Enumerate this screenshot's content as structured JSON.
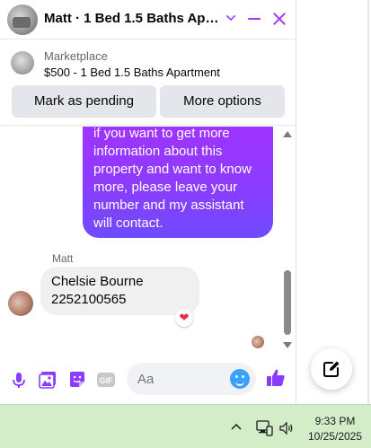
{
  "header": {
    "title": "Matt · 1 Bed 1.5 Baths Apar...",
    "chevron_icon": "chevron-down-icon",
    "minimize_icon": "minimize-icon",
    "close_icon": "close-icon",
    "accent_color": "#a933ff"
  },
  "listing": {
    "source": "Marketplace",
    "title": "$500 - 1 Bed 1.5 Baths Apartment",
    "buttons": {
      "mark_pending": "Mark as pending",
      "more_options": "More options"
    }
  },
  "messages": {
    "outgoing": {
      "lines": [
        "if you want to get more",
        "information about this",
        "property and want to know",
        "more, please leave your",
        "number and my assistant",
        "will contact."
      ],
      "gradient": [
        "#a033ff",
        "#6f4bff"
      ]
    },
    "incoming": {
      "sender": "Matt",
      "lines": [
        "Chelsie Bourne",
        "2252100565"
      ],
      "reaction": "❤"
    }
  },
  "composer": {
    "placeholder": "Aa",
    "icons": [
      "mic-icon",
      "photo-icon",
      "sticker-icon",
      "gif-icon",
      "emoji-icon",
      "thumbs-up-icon"
    ],
    "gif_label": "GIF"
  },
  "fab": {
    "icon": "compose-icon"
  },
  "taskbar": {
    "time": "9:33 PM",
    "date": "10/25/2025",
    "icons": [
      "chevron-up-icon",
      "network-icon",
      "volume-icon"
    ],
    "background": "#d4edc9"
  }
}
